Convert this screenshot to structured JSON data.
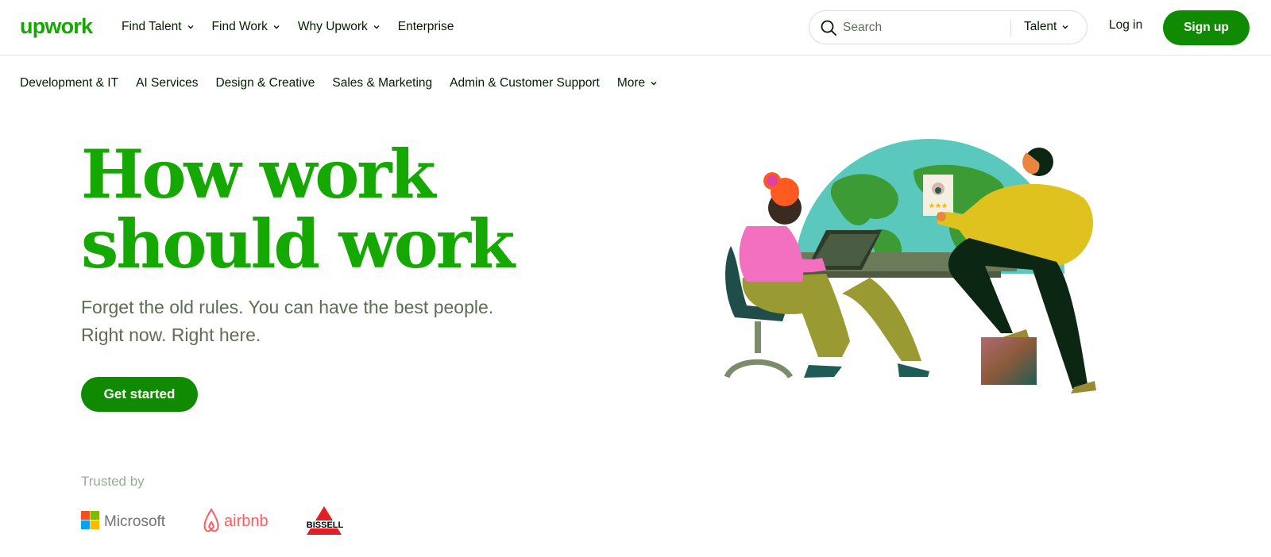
{
  "header": {
    "logo_text": "upwork",
    "nav": [
      {
        "label": "Find Talent",
        "has_dropdown": true
      },
      {
        "label": "Find Work",
        "has_dropdown": true
      },
      {
        "label": "Why Upwork",
        "has_dropdown": true
      },
      {
        "label": "Enterprise",
        "has_dropdown": false
      }
    ],
    "search": {
      "placeholder": "Search",
      "value": "",
      "scope": "Talent"
    },
    "login_label": "Log in",
    "signup_label": "Sign up"
  },
  "categories": [
    {
      "label": "Development & IT"
    },
    {
      "label": "AI Services"
    },
    {
      "label": "Design & Creative"
    },
    {
      "label": "Sales & Marketing"
    },
    {
      "label": "Admin & Customer Support"
    },
    {
      "label": "More",
      "has_dropdown": true
    }
  ],
  "hero": {
    "title_line1": "How work",
    "title_line2": "should work",
    "subtitle_line1": "Forget the old rules. You can have the best people.",
    "subtitle_line2": "Right now. Right here.",
    "cta_label": "Get started"
  },
  "trusted": {
    "label": "Trusted by",
    "brands": [
      "Microsoft",
      "airbnb",
      "BISSELL"
    ]
  },
  "colors": {
    "brand_green": "#14a800",
    "button_green": "#108a00",
    "text_dark": "#001e00",
    "text_muted": "#5e6d55"
  }
}
